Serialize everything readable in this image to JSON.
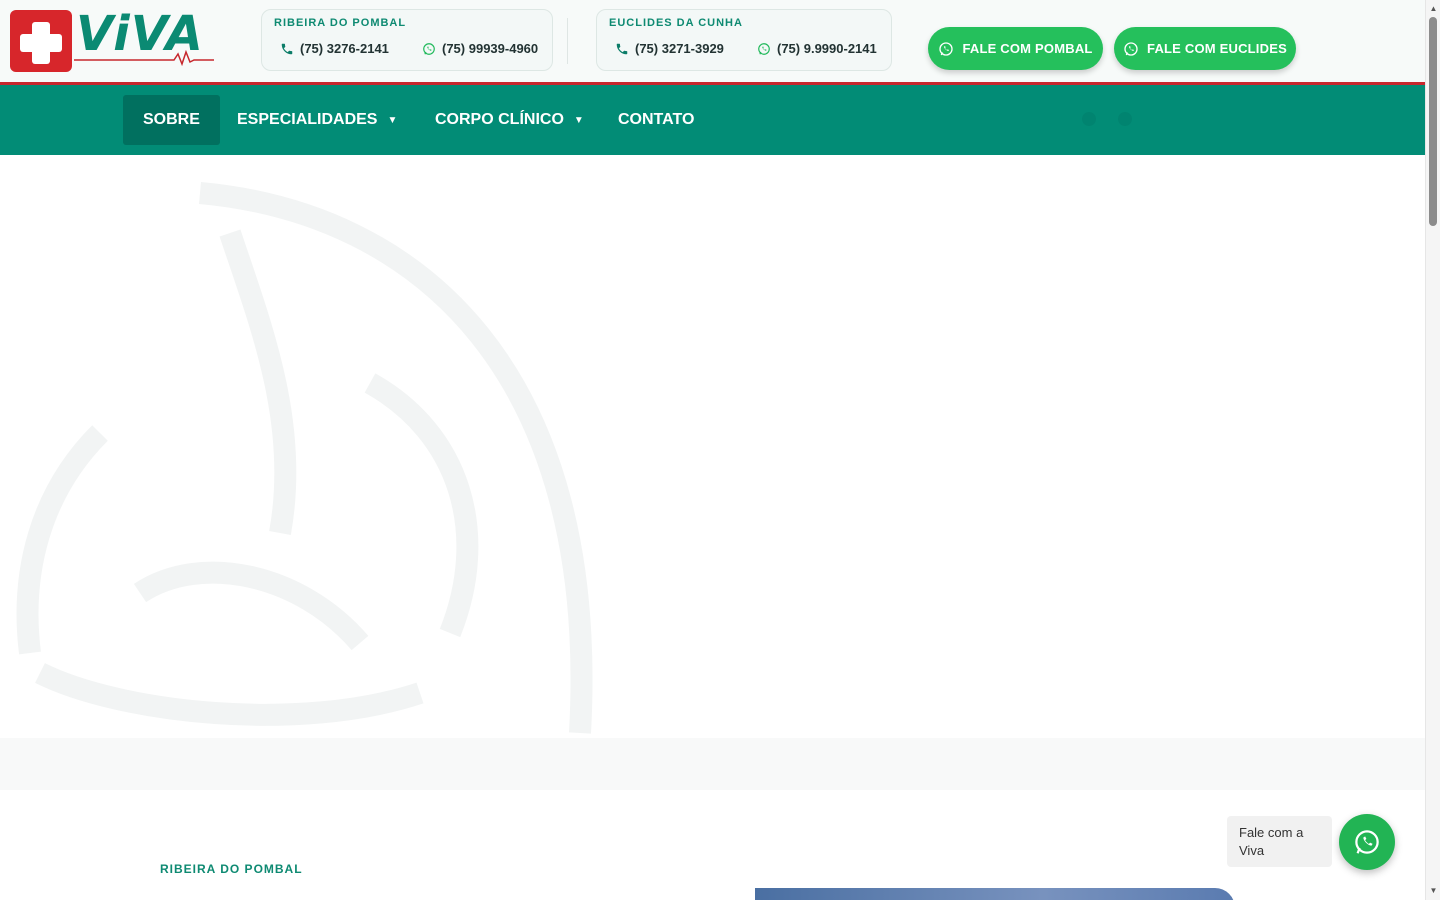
{
  "brand": {
    "logo_text": "ViVA"
  },
  "locations": [
    {
      "city": "RIBEIRA DO POMBAL",
      "phone": "(75) 3276-2141",
      "whatsapp": "(75) 99939-4960"
    },
    {
      "city": "EUCLIDES DA CUNHA",
      "phone": "(75) 3271-3929",
      "whatsapp": "(75) 9.9990-2141"
    }
  ],
  "cta": {
    "pombal_label": "FALE COM POMBAL",
    "euclides_label": "FALE COM EUCLIDES"
  },
  "nav": {
    "items": [
      {
        "label": "SOBRE",
        "active": true,
        "dropdown": false
      },
      {
        "label": "ESPECIALIDADES",
        "active": false,
        "dropdown": true
      },
      {
        "label": "CORPO CLÍNICO",
        "active": false,
        "dropdown": true
      },
      {
        "label": "CONTATO",
        "active": false,
        "dropdown": false
      }
    ],
    "chevron": "⌄"
  },
  "section": {
    "label": "RIBEIRA DO POMBAL"
  },
  "chat": {
    "bubble_text": "Fale com a Viva"
  },
  "colors": {
    "brand_green": "#028c76",
    "brand_red": "#c7272d",
    "whatsapp_green": "#25c05c",
    "text_teal": "#0e8a72"
  },
  "icons": {
    "phone": "phone-icon",
    "whatsapp": "whatsapp-icon",
    "chevron": "chevron-down-icon"
  }
}
